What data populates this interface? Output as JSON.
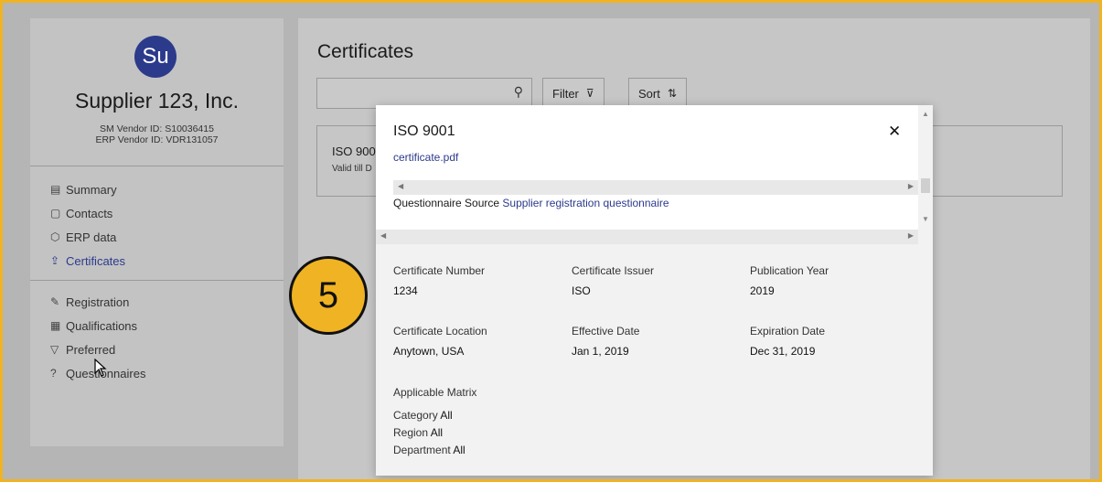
{
  "supplier": {
    "avatar_initials": "Su",
    "name": "Supplier 123, Inc.",
    "sm_vendor_id": "SM Vendor ID: S10036415",
    "erp_vendor_id": "ERP Vendor ID: VDR131057"
  },
  "nav_group1": [
    {
      "label": "Summary",
      "icon": "clipboard-icon",
      "glyph": "▤"
    },
    {
      "label": "Contacts",
      "icon": "contacts-icon",
      "glyph": "▢"
    },
    {
      "label": "ERP data",
      "icon": "erp-icon",
      "glyph": "⬡"
    },
    {
      "label": "Certificates",
      "icon": "certificate-icon",
      "glyph": "⇪"
    }
  ],
  "nav_group2": [
    {
      "label": "Registration",
      "icon": "pen-icon",
      "glyph": "✎"
    },
    {
      "label": "Qualifications",
      "icon": "qualifications-icon",
      "glyph": "▦"
    },
    {
      "label": "Preferred",
      "icon": "preferred-icon",
      "glyph": "▽"
    },
    {
      "label": "Questionnaires",
      "icon": "questionnaire-icon",
      "glyph": "?"
    }
  ],
  "main": {
    "title": "Certificates",
    "search_placeholder": "",
    "filter_label": "Filter",
    "sort_label": "Sort",
    "card_title": "ISO 900",
    "card_sub": "Valid till D"
  },
  "callout": {
    "number": "5"
  },
  "modal": {
    "title": "ISO 9001",
    "file_link": "certificate.pdf",
    "questionnaire_label": "Questionnaire Source",
    "questionnaire_link": "Supplier registration questionnaire",
    "fields": {
      "cert_number": {
        "label": "Certificate Number",
        "value": "1234"
      },
      "cert_issuer": {
        "label": "Certificate Issuer",
        "value": "ISO"
      },
      "pub_year": {
        "label": "Publication Year",
        "value": "2019"
      },
      "cert_location": {
        "label": "Certificate Location",
        "value": "Anytown, USA"
      },
      "effective_date": {
        "label": "Effective Date",
        "value": "Jan 1, 2019"
      },
      "expiration_date": {
        "label": "Expiration Date",
        "value": "Dec 31, 2019"
      }
    },
    "matrix": {
      "title": "Applicable Matrix",
      "category_label": "Category",
      "category_value": "All",
      "region_label": "Region",
      "region_value": "All",
      "department_label": "Department",
      "department_value": "All"
    }
  },
  "colors": {
    "accent": "#2c3a8c",
    "callout": "#f0b323"
  }
}
